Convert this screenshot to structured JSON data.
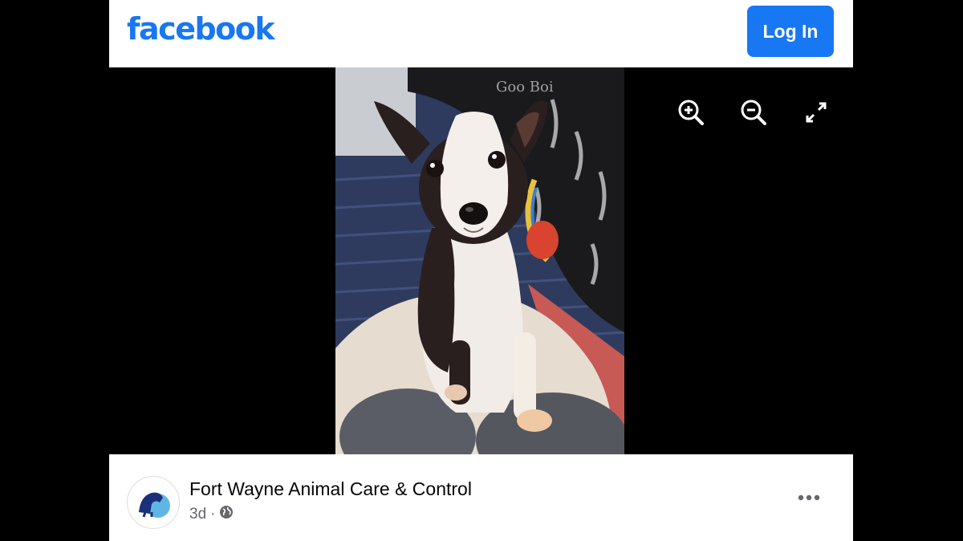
{
  "header": {
    "logo_text": "facebook",
    "login_label": "Log In"
  },
  "viewer": {
    "photo_subject": "black-and-white puppy sitting on a lap",
    "controls": [
      "zoom-in-icon",
      "zoom-out-icon",
      "fullscreen-icon"
    ]
  },
  "post": {
    "page_name": "Fort Wayne Animal Care & Control",
    "time": "3d",
    "separator": "·",
    "privacy_icon": "globe-icon",
    "menu_icon": "more-options-icon"
  },
  "colors": {
    "brand": "#1877f2",
    "secondary_text": "#65676b",
    "background": "#000000"
  }
}
